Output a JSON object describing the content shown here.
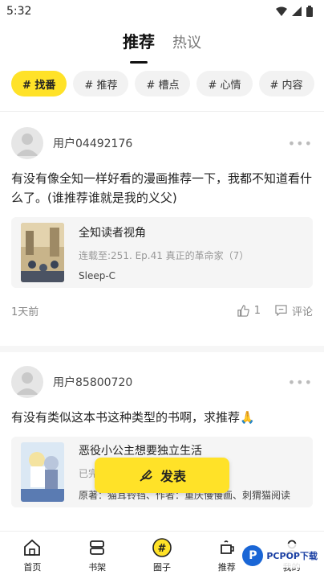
{
  "status_bar": {
    "time": "5:32"
  },
  "top_tabs": [
    {
      "label": "推荐",
      "active": true
    },
    {
      "label": "热议",
      "active": false
    }
  ],
  "chips": [
    {
      "label": "# 找番",
      "active": true
    },
    {
      "label": "# 推荐",
      "active": false
    },
    {
      "label": "# 槽点",
      "active": false
    },
    {
      "label": "# 心情",
      "active": false
    },
    {
      "label": "# 内容",
      "active": false
    }
  ],
  "posts": [
    {
      "username": "用户04492176",
      "text": "有没有像全知一样好看的漫画推荐一下，我都不知道看什么了。(谁推荐谁就是我的义父)",
      "card": {
        "title": "全知读者视角",
        "subtitle": "连载至:251. Ep.41 真正的革命家（7）",
        "author": "Sleep-C"
      },
      "time": "1天前",
      "likes": "1",
      "comment_label": "评论"
    },
    {
      "username": "用户85800720",
      "text": "有没有类似这本书这种类型的书啊，求推荐🙏",
      "card": {
        "title": "恶役小公主想要独立生活",
        "subtitle": "已完结",
        "author": "原著：猫耳铃铛、作者：重庆慢慢画、刺猬猫阅读"
      }
    }
  ],
  "publish_label": "发表",
  "bottom_nav": [
    {
      "label": "首页",
      "icon": "home-icon"
    },
    {
      "label": "书架",
      "icon": "bookshelf-icon"
    },
    {
      "label": "圈子",
      "icon": "circle-hash-icon"
    },
    {
      "label": "推荐",
      "icon": "recommend-icon"
    },
    {
      "label": "我的",
      "icon": "profile-icon"
    }
  ],
  "watermark": {
    "text": "PCPOP下载"
  },
  "colors": {
    "accent": "#ffe228",
    "text": "#222222",
    "muted": "#999999"
  }
}
